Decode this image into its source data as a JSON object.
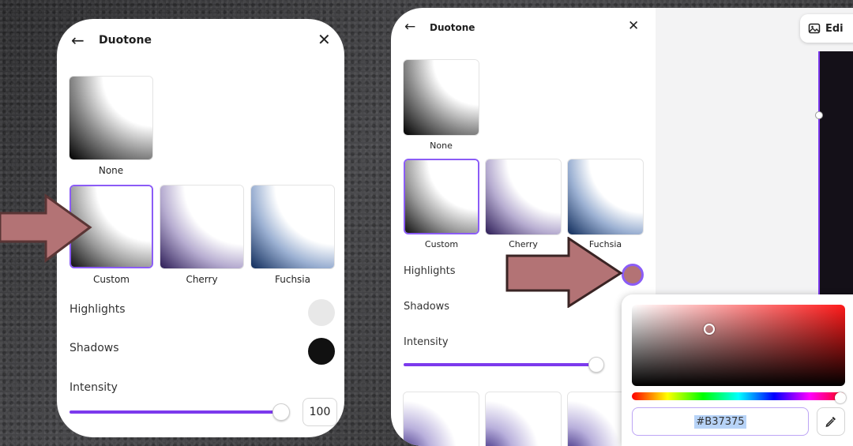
{
  "left_panel": {
    "title": "Duotone",
    "presets": [
      {
        "label": "None"
      },
      {
        "label": "Custom",
        "selected": true
      },
      {
        "label": "Cherry"
      },
      {
        "label": "Fuchsia"
      }
    ],
    "highlights_label": "Highlights",
    "highlights_color": "#e8e8e8",
    "shadows_label": "Shadows",
    "shadows_color": "#111111",
    "intensity_label": "Intensity",
    "intensity_value": "100",
    "intensity_fraction": 1.0
  },
  "right_panel": {
    "title": "Duotone",
    "presets": [
      {
        "label": "None"
      },
      {
        "label": "Custom",
        "selected": true
      },
      {
        "label": "Cherry"
      },
      {
        "label": "Fuchsia"
      }
    ],
    "highlights_label": "Highlights",
    "highlights_color": "#B37375",
    "shadows_label": "Shadows",
    "intensity_label": "Intensity",
    "intensity_fraction": 1.0
  },
  "toolbar": {
    "edit_label": "Edi"
  },
  "color_picker": {
    "hex_value": "#B37375"
  },
  "colors": {
    "accent": "#8b5cf6",
    "arrow": "#b37375"
  },
  "icons": {
    "back": "arrow-left-icon",
    "close": "close-icon",
    "edit": "edit-image-icon",
    "eyedropper": "eyedropper-icon"
  }
}
